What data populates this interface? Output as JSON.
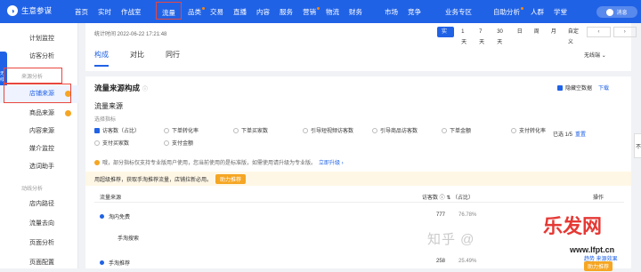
{
  "topbar": {
    "logo_text": "生意参谋",
    "nav": [
      {
        "label": "首页",
        "has_dot": false
      },
      {
        "label": "实时",
        "has_dot": false
      },
      {
        "label": "作战室",
        "has_dot": false
      },
      {
        "label": "流量",
        "has_dot": false
      },
      {
        "label": "品类",
        "has_dot": true
      },
      {
        "label": "交易",
        "has_dot": false
      },
      {
        "label": "直播",
        "has_dot": false
      },
      {
        "label": "内容",
        "has_dot": false
      },
      {
        "label": "服务",
        "has_dot": false
      },
      {
        "label": "营销",
        "has_dot": true
      },
      {
        "label": "物流",
        "has_dot": false
      },
      {
        "label": "财务",
        "has_dot": false
      },
      {
        "label": "市场",
        "has_dot": false
      },
      {
        "label": "竞争",
        "has_dot": false
      },
      {
        "label": "业务专区",
        "has_dot": false
      },
      {
        "label": "自助分析",
        "has_dot": true
      },
      {
        "label": "人群",
        "has_dot": false
      },
      {
        "label": "学堂",
        "has_dot": false
      }
    ],
    "messages_label": "消息"
  },
  "sidebar": {
    "items_top": [
      "计划监控",
      "访客分析"
    ],
    "group_source": "来源分析",
    "active_item": "店铺来源",
    "items_source": [
      "商品来源",
      "内容来源",
      "媒介监控",
      "选词助手"
    ],
    "group_path": "动线分析",
    "items_path": [
      "店内路径",
      "流量去向",
      "页面分析",
      "页面配置"
    ],
    "tab_label": "无线"
  },
  "top_card": {
    "stat_time": "统计时间 2022-06-22 17:21:48",
    "time_buttons": [
      "实时",
      "1天",
      "7天",
      "30天",
      "日",
      "周",
      "月",
      "自定义"
    ],
    "active_time": "实时",
    "tabs": [
      "构成",
      "对比",
      "同行"
    ],
    "active_tab": "构成",
    "device": "无线端"
  },
  "main_card": {
    "title": "流量来源构成",
    "title_hint": "ⓘ",
    "hide_empty_label": "隐藏空数据",
    "download_label": "下载",
    "subtitle": "流量来源",
    "metrics_label": "选择指标",
    "metrics_row1": [
      {
        "label": "访客数（占比）",
        "checked": true,
        "kind": "checkbox"
      },
      {
        "label": "下单转化率",
        "checked": false,
        "kind": "radio"
      },
      {
        "label": "下单买家数",
        "checked": false,
        "kind": "radio"
      },
      {
        "label": "引导短视频访客数",
        "checked": false,
        "kind": "radio"
      },
      {
        "label": "引导商品访客数",
        "checked": false,
        "kind": "radio"
      },
      {
        "label": "下单金额",
        "checked": false,
        "kind": "radio"
      },
      {
        "label": "支付转化率",
        "checked": false,
        "kind": "radio"
      }
    ],
    "metrics_row2": [
      {
        "label": "支付买家数",
        "checked": false,
        "kind": "radio"
      },
      {
        "label": "支付金额",
        "checked": false,
        "kind": "radio"
      }
    ],
    "choose_label": "已选 1/5",
    "reset_label": "重置",
    "notice_text": "哦，部分指标仅支持专业版用户使用，您当前使用的是标准版，如需使用请升级为专业版。",
    "notice_link": "立即升级 ›",
    "banner_text": "用超级推荐，获取手淘推荐流量，店铺拉新必用。",
    "banner_button": "助力推荐",
    "table_headers": {
      "source": "流量来源",
      "visitors": "访客数 ⓘ ⇅ （占比）",
      "operation": "操作"
    },
    "rows": [
      {
        "name": "淘内免费",
        "value": "777",
        "share": "76.78%",
        "op": "",
        "level": 0
      },
      {
        "name": "手淘搜索",
        "value": "",
        "share": "",
        "op": "",
        "level": 1
      },
      {
        "name": "手淘推荐",
        "value": "258",
        "share": "25.49%",
        "op": "趋势  来源效果",
        "level": 1
      }
    ],
    "row_button": "助力推荐"
  },
  "right_edge_label": "不",
  "watermark_text": "知乎 @",
  "watermark_logo": "乐发网",
  "watermark_url": "www.lfpt.cn"
}
